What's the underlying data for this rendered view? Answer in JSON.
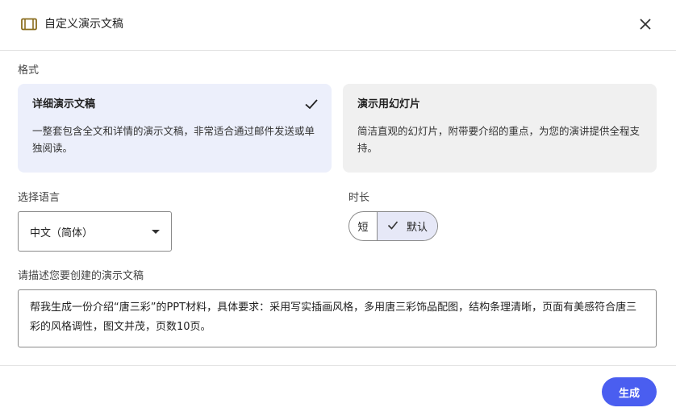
{
  "header": {
    "title": "自定义演示文稿",
    "icon": "slides-icon",
    "close_icon": "close-icon"
  },
  "format": {
    "label": "格式",
    "options": [
      {
        "title": "详细演示文稿",
        "description": "一整套包含全文和详情的演示文稿，非常适合通过邮件发送或单独阅读。",
        "selected": true
      },
      {
        "title": "演示用幻灯片",
        "description": "简洁直观的幻灯片，附带要介绍的重点，为您的演讲提供全程支持。",
        "selected": false
      }
    ]
  },
  "language": {
    "label": "选择语言",
    "value": "中文（简体）"
  },
  "duration": {
    "label": "时长",
    "options": [
      "短",
      "默认"
    ],
    "selected": "默认"
  },
  "description": {
    "label": "请描述您要创建的演示文稿",
    "value": "帮我生成一份介绍“唐三彩”的PPT材料，具体要求：采用写实插画风格，多用唐三彩饰品配图，结构条理清晰，页面有美感符合唐三彩的风格调性，图文并茂，页数10页。"
  },
  "actions": {
    "generate_label": "生成"
  },
  "colors": {
    "accent": "#4a5ef0",
    "selected_card_bg": "#eceffb",
    "card_bg": "#f0f0f0"
  }
}
